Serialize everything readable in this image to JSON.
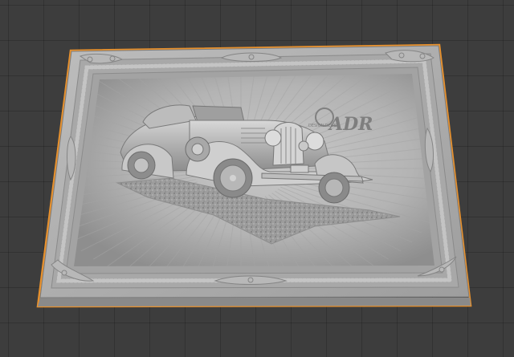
{
  "viewport": {
    "background_color": "#3d3d3d",
    "grid_color": "#2f2f2f",
    "selection_outline_color": "#e8912d"
  },
  "relief": {
    "object_color": "#9a9a9a",
    "emblem_text": "ADR",
    "emblem_subtext": "DESIGN RELIEF"
  }
}
